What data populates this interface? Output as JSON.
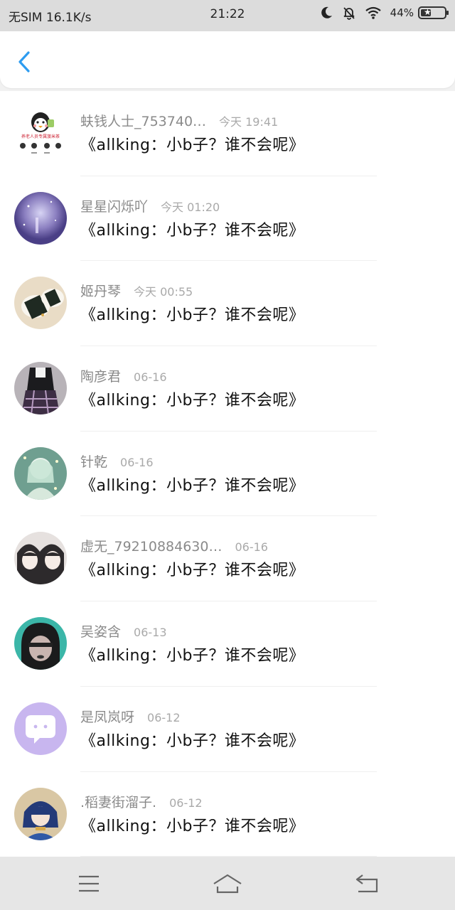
{
  "status_bar": {
    "carrier": "无SIM 16.1K/s",
    "time": "21:22",
    "battery": "44%",
    "battery_level": 0.44,
    "icons": [
      "moon-icon",
      "mute-bell-icon",
      "wifi-icon",
      "battery-icon"
    ]
  },
  "header": {
    "back_icon": "back-chevron-icon",
    "accent_color": "#2d9cf0"
  },
  "messages": [
    {
      "name": "蚨钱人士_753740…",
      "time": "今天 19:41",
      "text": "《allking：小b子？谁不会呢》",
      "avatar": "penguin-sticker"
    },
    {
      "name": "星星闪烁吖",
      "time": "今天 01:20",
      "text": "《allking：小b子？谁不会呢》",
      "avatar": "purple-sky"
    },
    {
      "name": "姬丹琴",
      "time": "今天 00:55",
      "text": "《allking：小b子？谁不会呢》",
      "avatar": "rice-rolls"
    },
    {
      "name": "陶彦君",
      "time": "06-16",
      "text": "《allking：小b子？谁不会呢》",
      "avatar": "plaid-skirt"
    },
    {
      "name": "针乾",
      "time": "06-16",
      "text": "《allking：小b子？谁不会呢》",
      "avatar": "green-anime"
    },
    {
      "name": "虚无_79210884630…",
      "time": "06-16",
      "text": "《allking：小b子？谁不会呢》",
      "avatar": "anime-pair"
    },
    {
      "name": "吴姿含",
      "time": "06-13",
      "text": "《allking：小b子？谁不会呢》",
      "avatar": "dark-hood"
    },
    {
      "name": "是凤岚呀",
      "time": "06-12",
      "text": "《allking：小b子？谁不会呢》",
      "avatar": "chat-bubble"
    },
    {
      "name": ".稻妻街溜子.",
      "time": "06-12",
      "text": "《allking：小b子？谁不会呢》",
      "avatar": "blue-anime"
    }
  ],
  "nav": {
    "icons": [
      "menu-icon",
      "home-icon",
      "back-icon"
    ]
  }
}
